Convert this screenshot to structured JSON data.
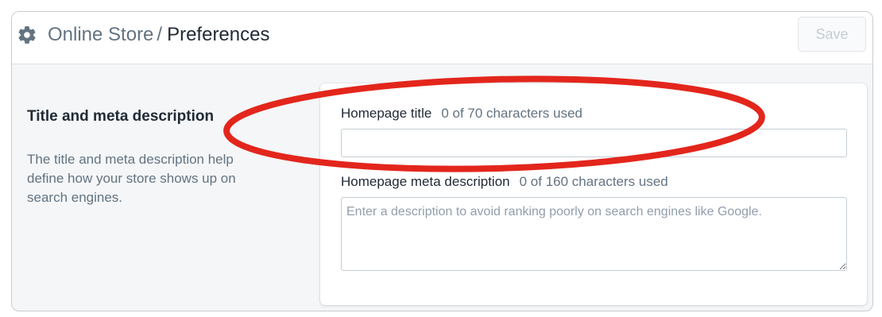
{
  "header": {
    "gear_icon": "gear-icon",
    "breadcrumb_parent": "Online Store",
    "breadcrumb_separator": "/",
    "page_title": "Preferences",
    "save_label": "Save"
  },
  "section": {
    "title": "Title and meta description",
    "description": "The title and meta description help define how your store shows up on search engines."
  },
  "form": {
    "homepage_title": {
      "label": "Homepage title",
      "counter": "0 of 70 characters used",
      "value": ""
    },
    "meta_description": {
      "label": "Homepage meta description",
      "counter": "0 of 160 characters used",
      "placeholder": "Enter a description to avoid ranking poorly on search engines like Google.",
      "value": ""
    }
  },
  "colors": {
    "annotation": "#e3261c",
    "save_text_disabled": "#c4cdd5",
    "page_background": "#f4f6f8"
  }
}
